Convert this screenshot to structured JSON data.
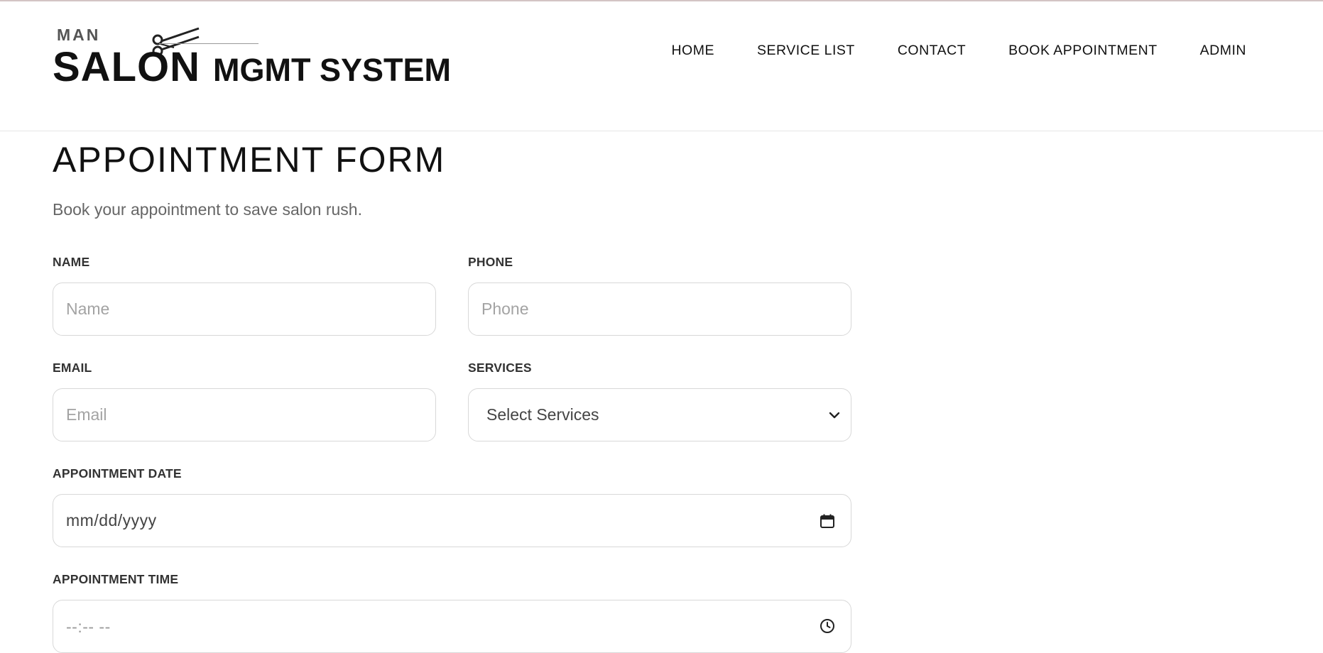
{
  "header": {
    "logo": {
      "small_text": "MAN",
      "main_text": "SALON",
      "suffix_text": "MGMT SYSTEM",
      "icon": "scissors-icon"
    },
    "nav": {
      "home": "HOME",
      "service_list": "SERVICE LIST",
      "contact": "CONTACT",
      "book_appointment": "BOOK APPOINTMENT",
      "admin": "ADMIN"
    }
  },
  "form": {
    "title": "APPOINTMENT FORM",
    "subtitle": "Book your appointment to save salon rush.",
    "name": {
      "label": "NAME",
      "placeholder": "Name",
      "value": ""
    },
    "phone": {
      "label": "PHONE",
      "placeholder": "Phone",
      "value": ""
    },
    "email": {
      "label": "EMAIL",
      "placeholder": "Email",
      "value": ""
    },
    "services": {
      "label": "SERVICES",
      "selected": "Select Services",
      "icon": "chevron-down-icon"
    },
    "date": {
      "label": "APPOINTMENT DATE",
      "placeholder": "mm/dd/yyyy",
      "icon": "calendar-icon"
    },
    "time": {
      "label": "APPOINTMENT TIME",
      "placeholder": "--:-- --",
      "icon": "clock-icon"
    }
  },
  "colors": {
    "text": "#111111",
    "muted": "#666666",
    "border": "#d8d8d8",
    "top_rule": "#d3c4c4"
  }
}
